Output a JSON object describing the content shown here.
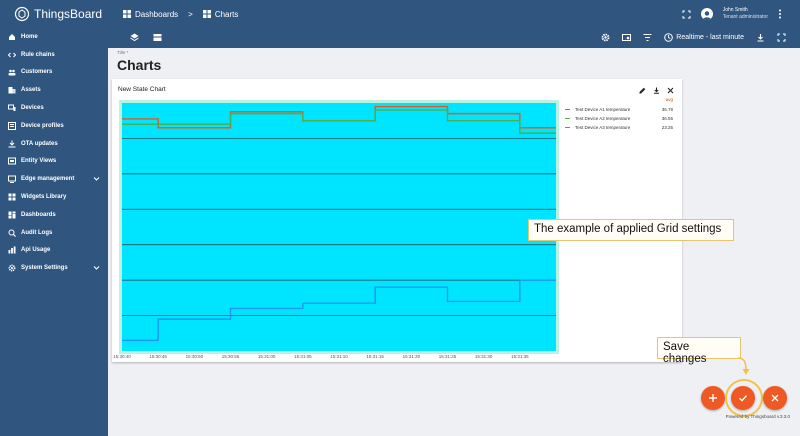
{
  "app": {
    "brand": "ThingsBoard"
  },
  "sidebar": {
    "items": [
      {
        "label": "Home",
        "icon": "home-icon"
      },
      {
        "label": "Rule chains",
        "icon": "code-icon"
      },
      {
        "label": "Customers",
        "icon": "people-icon"
      },
      {
        "label": "Assets",
        "icon": "domain-icon"
      },
      {
        "label": "Devices",
        "icon": "devices-icon"
      },
      {
        "label": "Device profiles",
        "icon": "profile-icon"
      },
      {
        "label": "OTA updates",
        "icon": "update-icon"
      },
      {
        "label": "Entity Views",
        "icon": "view-icon"
      },
      {
        "label": "Edge management",
        "icon": "edge-icon",
        "expandable": true
      },
      {
        "label": "Widgets Library",
        "icon": "widgets-icon"
      },
      {
        "label": "Dashboards",
        "icon": "dashboard-icon"
      },
      {
        "label": "Audit Logs",
        "icon": "audit-icon"
      },
      {
        "label": "Api Usage",
        "icon": "api-icon"
      },
      {
        "label": "System Settings",
        "icon": "settings-icon",
        "expandable": true
      }
    ]
  },
  "header": {
    "breadcrumb": [
      "Dashboards",
      ">",
      "Charts"
    ],
    "user_name": "John Smith",
    "user_role": "Tenant administrator"
  },
  "toolbar": {
    "timewindow_label": "Realtime - last minute"
  },
  "page": {
    "title_label": "Title *",
    "title": "Charts"
  },
  "widget": {
    "title": "New State Chart",
    "legend_header": "avg",
    "legend": [
      {
        "name": "Test Device A1 temperature",
        "value": "36.78",
        "color": "#e25a1c"
      },
      {
        "name": "Test Device A2 temperature",
        "value": "36.55",
        "color": "#4caf50"
      },
      {
        "name": "Test Device A3 temperature",
        "value": "23.25",
        "color": "#2196f3"
      }
    ]
  },
  "chart_data": {
    "type": "line",
    "step": true,
    "background_color": "#00e5ff",
    "grid_color": "#2a3b4d",
    "x_ticks": [
      "15:30:40",
      "15:30:45",
      "15:30:50",
      "15:30:55",
      "15:31:00",
      "15:31:05",
      "15:31:10",
      "15:31:15",
      "15:31:20",
      "15:31:25",
      "15:31:30",
      "15:31:35"
    ],
    "ylim": [
      0,
      7
    ],
    "series": [
      {
        "name": "Test Device A1 temperature",
        "color": "#e25a1c",
        "x": [
          0,
          5,
          15,
          25,
          35,
          45,
          55,
          60
        ],
        "y": [
          6.55,
          6.3,
          6.75,
          6.5,
          6.9,
          6.7,
          6.3,
          6.3
        ]
      },
      {
        "name": "Test Device A2 temperature",
        "color": "#4caf50",
        "x": [
          0,
          5,
          15,
          25,
          35,
          45,
          55,
          60
        ],
        "y": [
          6.4,
          6.4,
          6.7,
          6.5,
          6.8,
          6.5,
          6.15,
          6.15
        ]
      },
      {
        "name": "Test Device A3 temperature",
        "color": "#2196f3",
        "x": [
          0,
          5,
          15,
          25,
          35,
          45,
          55,
          60
        ],
        "y": [
          0.3,
          0.9,
          1.2,
          1.35,
          1.8,
          1.4,
          2.0,
          2.0
        ]
      }
    ]
  },
  "annotations": {
    "grid_note": "The example of applied Grid settings",
    "save_note": "Save changes",
    "highlight_color": "#f2c24e"
  },
  "footer": {
    "powered": "Powered by Thingsboard v.3.3.0"
  }
}
